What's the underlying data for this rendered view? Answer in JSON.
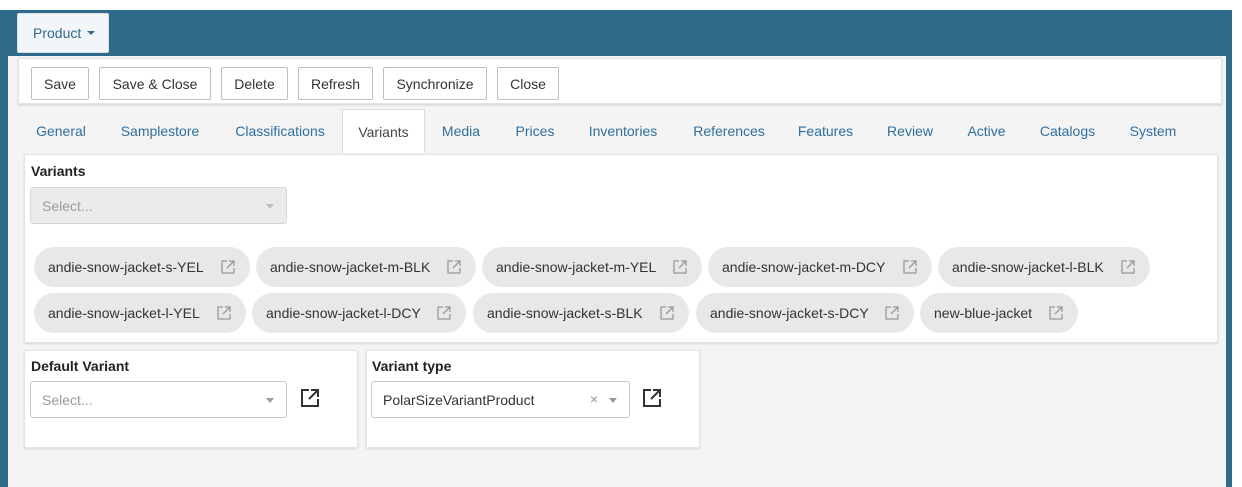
{
  "header": {
    "product_menu_label": "Product"
  },
  "toolbar": {
    "save": "Save",
    "save_close": "Save & Close",
    "delete": "Delete",
    "refresh": "Refresh",
    "synchronize": "Synchronize",
    "close": "Close"
  },
  "tabs": [
    {
      "label": "General"
    },
    {
      "label": "Samplestore"
    },
    {
      "label": "Classifications"
    },
    {
      "label": "Variants",
      "active": true
    },
    {
      "label": "Media"
    },
    {
      "label": "Prices"
    },
    {
      "label": "Inventories"
    },
    {
      "label": "References"
    },
    {
      "label": "Features"
    },
    {
      "label": "Review"
    },
    {
      "label": "Active"
    },
    {
      "label": "Catalogs"
    },
    {
      "label": "System"
    }
  ],
  "variants": {
    "label": "Variants",
    "select_placeholder": "Select...",
    "chips": [
      "andie-snow-jacket-s-YEL",
      "andie-snow-jacket-m-BLK",
      "andie-snow-jacket-m-YEL",
      "andie-snow-jacket-m-DCY",
      "andie-snow-jacket-l-BLK",
      "andie-snow-jacket-l-YEL",
      "andie-snow-jacket-l-DCY",
      "andie-snow-jacket-s-BLK",
      "andie-snow-jacket-s-DCY",
      "new-blue-jacket"
    ]
  },
  "default_variant": {
    "label": "Default Variant",
    "placeholder": "Select..."
  },
  "variant_type": {
    "label": "Variant type",
    "value": "PolarSizeVariantProduct",
    "clear_symbol": "×"
  },
  "colors": {
    "header": "#2f6a8a",
    "link": "#2f6f9e",
    "chip": "#e8e8e8"
  },
  "icons": {
    "chip_open": "external-link-icon",
    "field_open": "external-link-icon"
  }
}
